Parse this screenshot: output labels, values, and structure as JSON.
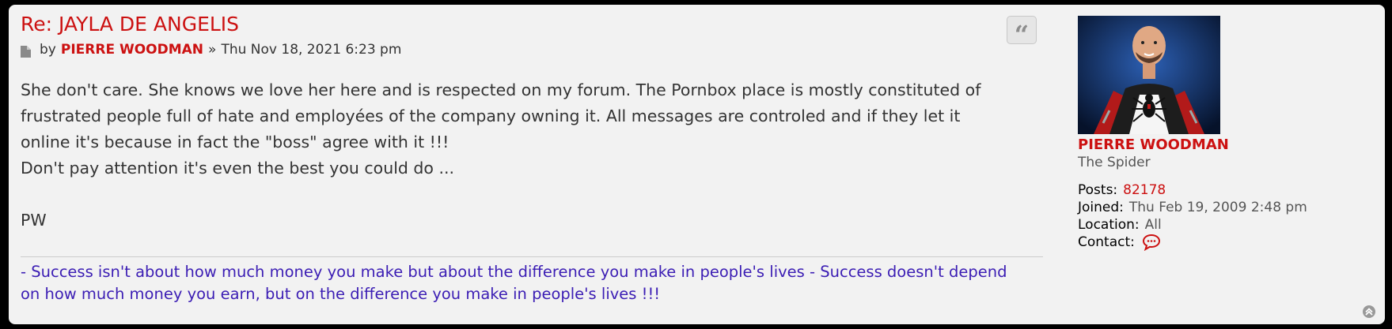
{
  "post": {
    "title": "Re: JAYLA DE ANGELIS",
    "by_label": "by",
    "author": "PIERRE WOODMAN",
    "separator": "»",
    "datetime": "Thu Nov 18, 2021 6:23 pm",
    "content_lines": [
      "She don't care. She knows we love her here and is respected on my forum. The Pornbox place is mostly constituted of",
      "frustrated people full of hate and employées of the company owning it. All messages are controled and if they let it",
      "online it's because in fact the \"boss\" agree with it !!!",
      "Don't pay attention it's even the best you could do ...",
      "PW"
    ],
    "signature_lines": [
      "- Success isn't about how much money you make but about the difference you make in people's lives - Success doesn't depend",
      "on how much money you earn, but on the difference you make in people's lives !!!"
    ],
    "quote_icon": "quote-icon"
  },
  "profile": {
    "name": "PIERRE WOODMAN",
    "rank": "The Spider",
    "posts_label": "Posts:",
    "posts_value": "82178",
    "joined_label": "Joined:",
    "joined_value": "Thu Feb 19, 2009 2:48 pm",
    "location_label": "Location:",
    "location_value": "All",
    "contact_label": "Contact:",
    "contact_icon": "chat-bubble-icon"
  },
  "colors": {
    "title": "#cc1111",
    "signature": "#3b1db4",
    "panel": "#f2f2f2",
    "background": "#000000"
  }
}
